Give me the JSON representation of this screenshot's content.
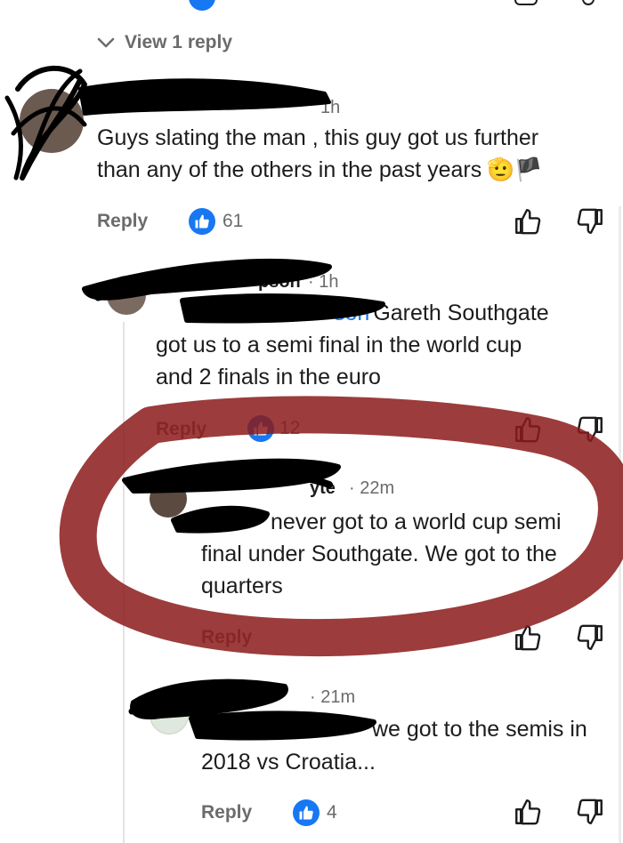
{
  "top": {
    "view_replies": "View 1 reply"
  },
  "comments": [
    {
      "time": "1h",
      "text_line1": "Guys slating the man , this guy got us further",
      "text_line2": "than any of the others in the past years",
      "emoji": "🫡🏴",
      "reply_label": "Reply",
      "likes": "61"
    },
    {
      "author_partial": "pson",
      "time": "· 1h",
      "mention_partial": "son",
      "text_line1": "Gareth Southgate",
      "text_line2": "got us to a semi final in the world cup",
      "text_line3": "and 2 finals in the euro",
      "reply_label": "Reply",
      "likes": "12"
    },
    {
      "author_partial": "yte",
      "time": "· 22m",
      "text_line1": "never got to a world cup semi",
      "text_line2": "final under Southgate. We got to the",
      "text_line3": "quarters",
      "reply_label": "Reply"
    },
    {
      "time": "· 21m",
      "text_line1": "we got to the semis in",
      "text_line2": "2018 vs Croatia...",
      "reply_label": "Reply",
      "likes": "4"
    }
  ],
  "colors": {
    "like_blue": "#1877f2",
    "annotation_red": "#8b1a1a",
    "redaction_black": "#000000"
  },
  "icons": {
    "thumbs_up": "thumbs-up-icon",
    "thumbs_down": "thumbs-down-icon",
    "chevron": "chevron-down-icon"
  }
}
